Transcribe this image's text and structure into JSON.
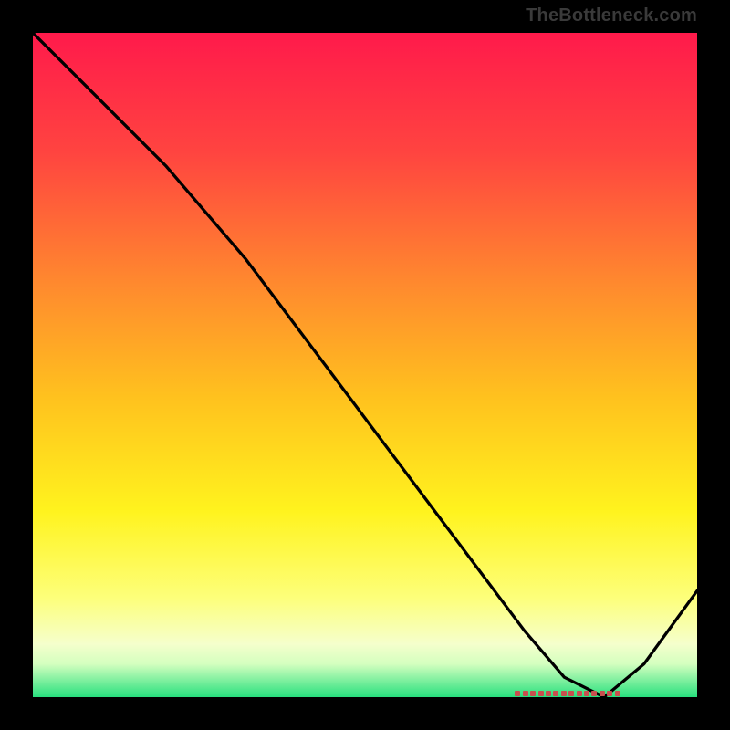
{
  "watermark": "TheBottleneck.com",
  "chart_data": {
    "type": "line",
    "title": "",
    "xlabel": "",
    "ylabel": "",
    "xlim": [
      0,
      100
    ],
    "ylim": [
      0,
      100
    ],
    "gradient_stops": [
      {
        "offset": 0,
        "color": "#ff1a4b"
      },
      {
        "offset": 18,
        "color": "#ff4440"
      },
      {
        "offset": 38,
        "color": "#ff8a2e"
      },
      {
        "offset": 55,
        "color": "#ffc21e"
      },
      {
        "offset": 72,
        "color": "#fff31e"
      },
      {
        "offset": 85,
        "color": "#fdff7a"
      },
      {
        "offset": 92,
        "color": "#f5ffcc"
      },
      {
        "offset": 95,
        "color": "#d4ffbf"
      },
      {
        "offset": 100,
        "color": "#28e07e"
      }
    ],
    "series": [
      {
        "name": "curve",
        "x": [
          0,
          7,
          14,
          20,
          26,
          32,
          38,
          44,
          50,
          56,
          62,
          68,
          74,
          80,
          86,
          92,
          100
        ],
        "y": [
          100,
          93,
          86,
          80,
          73,
          66,
          58,
          50,
          42,
          34,
          26,
          18,
          10,
          3,
          0,
          5,
          16
        ]
      }
    ],
    "scatter_band": {
      "name": "scatter",
      "y": 0.5,
      "x_start": 73,
      "x_end": 88,
      "count": 14
    }
  }
}
